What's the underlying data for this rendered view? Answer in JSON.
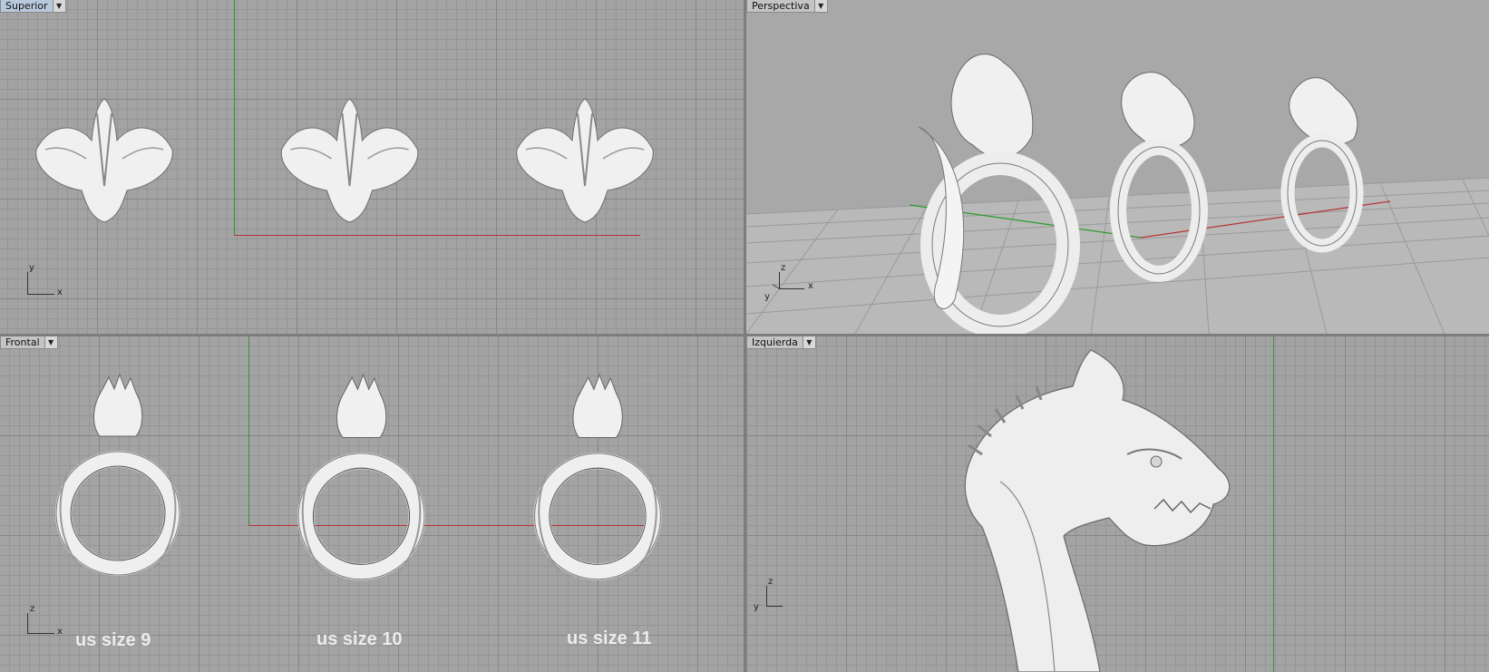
{
  "viewports": {
    "top": {
      "label": "Superior",
      "dropdown": "▼",
      "axis_x": "x",
      "axis_y": "y"
    },
    "perspective": {
      "label": "Perspectiva",
      "dropdown": "▼",
      "axis_x": "x",
      "axis_y": "y",
      "axis_z": "z"
    },
    "front": {
      "label": "Frontal",
      "dropdown": "▼",
      "axis_x": "x",
      "axis_z": "z"
    },
    "left": {
      "label": "Izquierda",
      "dropdown": "▼",
      "axis_y": "y",
      "axis_z": "z"
    }
  },
  "size_labels": [
    "us size 9",
    "us size 10",
    "us size 11"
  ],
  "colors": {
    "grid_bg": "#a3a3a3",
    "x_axis": "#b83333",
    "y_axis": "#2b9a2b",
    "active_tab": "#b9c9dd",
    "model": "#f2f2f2"
  }
}
